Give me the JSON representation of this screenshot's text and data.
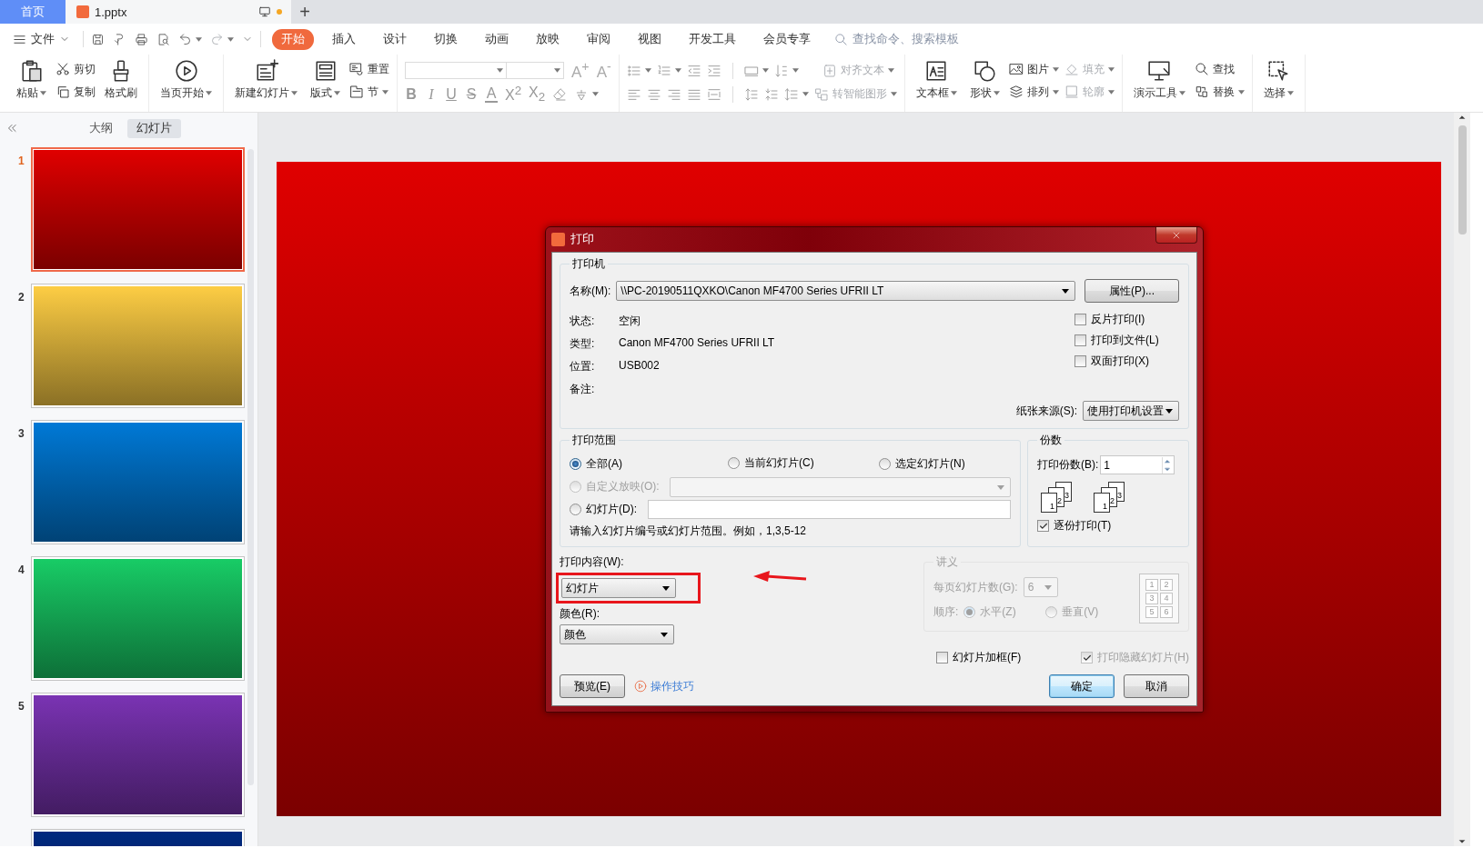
{
  "tab_bar": {
    "home_tab": "首页",
    "document_tab": {
      "title": "1.pptx",
      "unsaved": true
    },
    "new_tab": "+"
  },
  "menu": {
    "file": "文件",
    "tabs": [
      {
        "label": "开始",
        "selected": true
      },
      {
        "label": "插入",
        "selected": false
      },
      {
        "label": "设计",
        "selected": false
      },
      {
        "label": "切换",
        "selected": false
      },
      {
        "label": "动画",
        "selected": false
      },
      {
        "label": "放映",
        "selected": false
      },
      {
        "label": "审阅",
        "selected": false
      },
      {
        "label": "视图",
        "selected": false
      },
      {
        "label": "开发工具",
        "selected": false
      },
      {
        "label": "会员专享",
        "selected": false
      }
    ],
    "search": {
      "placeholder": "查找命令、搜索模板"
    }
  },
  "ribbon": {
    "paste": {
      "label": "粘贴",
      "dropdown": true
    },
    "cut": {
      "label": "剪切"
    },
    "copy": {
      "label": "复制"
    },
    "format_painter": {
      "label": "格式刷"
    },
    "play_from_current": {
      "label": "当页开始",
      "dropdown": true
    },
    "new_slide": {
      "label": "新建幻灯片",
      "dropdown": true
    },
    "layout": {
      "label": "版式",
      "dropdown": true
    },
    "reset": {
      "label": "重置"
    },
    "section": {
      "label": "节",
      "dropdown": true
    },
    "font_grow": "A$^{+}$",
    "font_shrink": "A$^{-}$",
    "font_styles": [
      "B",
      "I",
      "U",
      "S",
      "A",
      "X$^{2}$",
      "X$_{2}$"
    ],
    "align_text": {
      "label": "对齐文本",
      "dropdown": true,
      "disabled": true
    },
    "smartart": {
      "label": "转智能图形",
      "dropdown": true,
      "disabled": true
    },
    "text_box": {
      "label": "文本框",
      "dropdown": true
    },
    "shape": {
      "label": "形状",
      "dropdown": true
    },
    "picture": {
      "label": "图片",
      "dropdown": true
    },
    "arrange": {
      "label": "排列",
      "dropdown": true
    },
    "fill": {
      "label": "填充",
      "dropdown": true,
      "disabled": true
    },
    "outline": {
      "label": "轮廓",
      "dropdown": true,
      "disabled": true
    },
    "presenter_tools": {
      "label": "演示工具",
      "dropdown": true
    },
    "find": {
      "label": "查找"
    },
    "replace": {
      "label": "替换",
      "dropdown": true
    },
    "select": {
      "label": "选择",
      "dropdown": true
    }
  },
  "sidebar": {
    "tabs": [
      {
        "label": "大纲",
        "selected": false
      },
      {
        "label": "幻灯片",
        "selected": true
      }
    ],
    "slides": [
      {
        "number": "1",
        "color": "#e00000",
        "selected": true
      },
      {
        "number": "2",
        "color": "#fdcd44",
        "selected": false
      },
      {
        "number": "3",
        "color": "#0079d6",
        "selected": false
      },
      {
        "number": "4",
        "color": "#18cc66",
        "selected": false
      },
      {
        "number": "5",
        "color": "#7a33b3",
        "selected": false
      },
      {
        "color": "#00297f",
        "selected": false
      }
    ]
  },
  "print_dialog": {
    "title": "打印",
    "printer": {
      "legend": "打印机",
      "name_label": "名称(M):",
      "name_value": "\\\\PC-20190511QXKO\\Canon MF4700 Series UFRII LT",
      "properties_button": "属性(P)...",
      "info": [
        {
          "label": "状态:",
          "value": "空闲"
        },
        {
          "label": "类型:",
          "value": "Canon MF4700 Series UFRII LT"
        },
        {
          "label": "位置:",
          "value": "USB002"
        },
        {
          "label": "备注:"
        }
      ],
      "options": [
        {
          "label": "反片打印(I)",
          "checked": false
        },
        {
          "label": "打印到文件(L)",
          "checked": false
        },
        {
          "label": "双面打印(X)",
          "checked": false
        }
      ],
      "paper_source_label": "纸张来源(S):",
      "paper_source_value": "使用打印机设置"
    },
    "range": {
      "legend": "打印范围",
      "choices": [
        {
          "label": "全部(A)",
          "selected": true,
          "disabled": false
        },
        {
          "label": "当前幻灯片(C)",
          "selected": false,
          "disabled": false
        },
        {
          "label": "选定幻灯片(N)",
          "selected": false,
          "disabled": false
        },
        {
          "label": "自定义放映(O):",
          "selected": false,
          "disabled": true
        },
        {
          "label": "幻灯片(D):",
          "selected": false,
          "disabled": false
        }
      ],
      "hint": "请输入幻灯片编号或幻灯片范围。例如，1,3,5-12"
    },
    "copies": {
      "legend": "份数",
      "count_label": "打印份数(B):",
      "count_value": "1",
      "illustrations": [
        [
          "3",
          "2",
          "1"
        ],
        [
          "3",
          "2",
          "1"
        ]
      ],
      "collate": {
        "label": "逐份打印(T)",
        "checked": true
      }
    },
    "content": {
      "label": "打印内容(W):",
      "value": "幻灯片"
    },
    "color": {
      "label": "颜色(R):",
      "value": "颜色"
    },
    "handouts": {
      "legend": "讲义",
      "disabled": true,
      "per_page_label": "每页幻灯片数(G):",
      "per_page_value": "6",
      "order_label": "顺序:",
      "order": [
        {
          "label": "水平(Z)",
          "selected": true
        },
        {
          "label": "垂直(V)",
          "selected": false
        }
      ],
      "preview_numbers": [
        "1",
        "2",
        "3",
        "4",
        "5",
        "6"
      ]
    },
    "frame_slides": {
      "label": "幻灯片加框(F)",
      "checked": false,
      "disabled": false
    },
    "print_hidden": {
      "label": "打印隐藏幻灯片(H)",
      "checked": true,
      "disabled": true
    },
    "preview_button": "预览(E)",
    "tips_link": "操作技巧",
    "ok_button": "确定",
    "cancel_button": "取消"
  }
}
